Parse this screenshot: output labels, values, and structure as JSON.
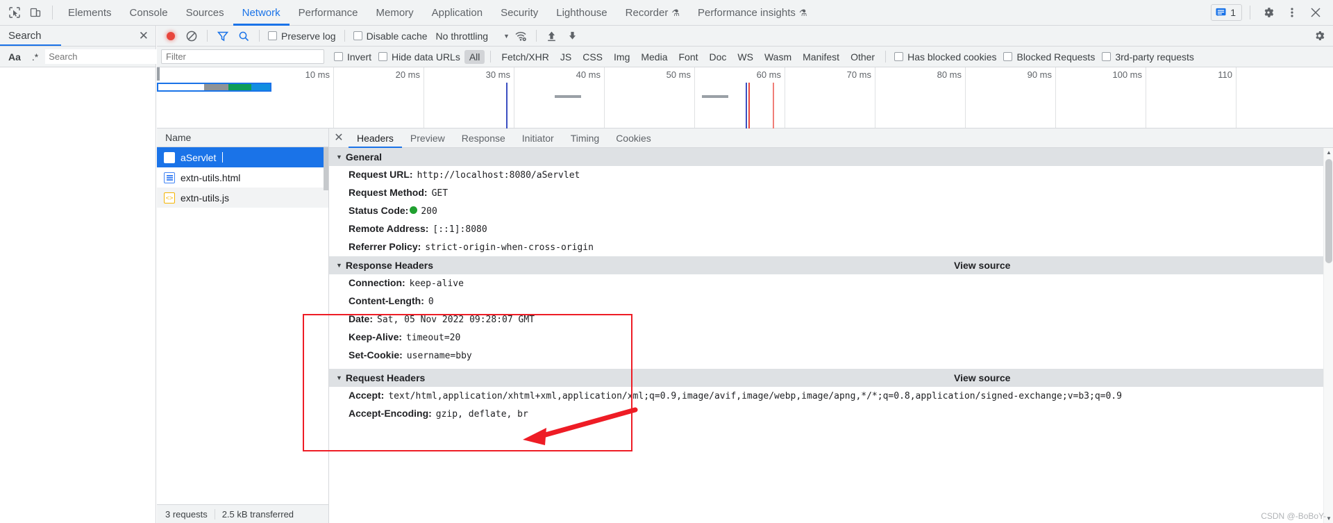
{
  "tabbar": {
    "icons": [
      "inspect-icon",
      "device-toolbar-icon"
    ],
    "tabs": [
      {
        "label": "Elements",
        "flask": false
      },
      {
        "label": "Console",
        "flask": false
      },
      {
        "label": "Sources",
        "flask": false
      },
      {
        "label": "Network",
        "flask": false
      },
      {
        "label": "Performance",
        "flask": false
      },
      {
        "label": "Memory",
        "flask": false
      },
      {
        "label": "Application",
        "flask": false
      },
      {
        "label": "Security",
        "flask": false
      },
      {
        "label": "Lighthouse",
        "flask": false
      },
      {
        "label": "Recorder",
        "flask": true
      },
      {
        "label": "Performance insights",
        "flask": true
      }
    ],
    "active_tab": "Network",
    "issues_count": "1",
    "flask_glyph": "⚗",
    "settings_glyph": "⚙",
    "more_glyph": "⋮",
    "close_glyph": "✕"
  },
  "sidebar": {
    "title": "Search",
    "close_glyph": "✕",
    "case_label": "Aa",
    "regex_label": ".*",
    "search_placeholder": "Search",
    "search_value": "",
    "refresh_glyph": "⟳",
    "clear_glyph": "⃠"
  },
  "network_toolbar": {
    "record_label": "record",
    "clear_glyph": "⃠",
    "filter_glyph": "filter",
    "search_glyph": "search",
    "preserve_log": "Preserve log",
    "disable_cache": "Disable cache",
    "throttling": "No throttling",
    "caret": "▼",
    "wifi_glyph": "wifi",
    "import_glyph": "↑",
    "export_glyph": "↓",
    "settings_glyph": "⚙"
  },
  "filter_toolbar": {
    "filter_placeholder": "Filter",
    "filter_value": "",
    "invert": "Invert",
    "hide_data_urls": "Hide data URLs",
    "types": [
      "All",
      "Fetch/XHR",
      "JS",
      "CSS",
      "Img",
      "Media",
      "Font",
      "Doc",
      "WS",
      "Wasm",
      "Manifest",
      "Other"
    ],
    "selected_type": "All",
    "has_blocked_cookies": "Has blocked cookies",
    "blocked_requests": "Blocked Requests",
    "third_party_requests": "3rd-party requests"
  },
  "overview": {
    "ticks": [
      "10 ms",
      "20 ms",
      "30 ms",
      "40 ms",
      "50 ms",
      "60 ms",
      "70 ms",
      "80 ms",
      "90 ms",
      "100 ms",
      "110"
    ],
    "bar": {
      "total_label": "aServlet",
      "segments": [
        {
          "name": "queue",
          "color": "#ffffff"
        },
        {
          "name": "stalled",
          "color": "#8f9396"
        },
        {
          "name": "waiting-ttfb",
          "color": "#0d9d58"
        },
        {
          "name": "content-download",
          "color": "#108ee0"
        }
      ],
      "outline_color": "#1a73e8"
    },
    "events": [
      {
        "name": "dom-content-loaded",
        "color": "#3a4ec1"
      },
      {
        "name": "dom-content-loaded-2",
        "color": "#3a4ec1"
      },
      {
        "name": "load-event",
        "color": "#e8453c"
      },
      {
        "name": "load-event-2",
        "color": "#f07e77"
      }
    ]
  },
  "request_list": {
    "column": "Name",
    "rows": [
      {
        "name": "aServlet",
        "icon": "document-icon",
        "selected": true
      },
      {
        "name": "extn-utils.html",
        "icon": "document-icon",
        "selected": false
      },
      {
        "name": "extn-utils.js",
        "icon": "script-icon",
        "selected": false
      }
    ],
    "status": {
      "requests": "3 requests",
      "transferred": "2.5 kB transferred"
    }
  },
  "detail": {
    "close_glyph": "✕",
    "tabs": [
      "Headers",
      "Preview",
      "Response",
      "Initiator",
      "Timing",
      "Cookies"
    ],
    "active_tab": "Headers",
    "view_source_label": "View source",
    "sections": [
      {
        "title": "General",
        "has_view_source": false,
        "rows": [
          {
            "key": "Request URL:",
            "value": "http://localhost:8080/aServlet"
          },
          {
            "key": "Request Method:",
            "value": "GET"
          },
          {
            "key": "Status Code:",
            "value": "200",
            "status_dot": "#20a030"
          },
          {
            "key": "Remote Address:",
            "value": "[::1]:8080"
          },
          {
            "key": "Referrer Policy:",
            "value": "strict-origin-when-cross-origin"
          }
        ]
      },
      {
        "title": "Response Headers",
        "has_view_source": true,
        "rows": [
          {
            "key": "Connection:",
            "value": "keep-alive"
          },
          {
            "key": "Content-Length:",
            "value": "0"
          },
          {
            "key": "Date:",
            "value": "Sat, 05 Nov 2022 09:28:07 GMT"
          },
          {
            "key": "Keep-Alive:",
            "value": "timeout=20"
          },
          {
            "key": "Set-Cookie:",
            "value": "username=bby"
          }
        ]
      },
      {
        "title": "Request Headers",
        "has_view_source": true,
        "rows": [
          {
            "key": "Accept:",
            "value": "text/html,application/xhtml+xml,application/xml;q=0.9,image/avif,image/webp,image/apng,*/*;q=0.8,application/signed-exchange;v=b3;q=0.9"
          },
          {
            "key": "Accept-Encoding:",
            "value": "gzip, deflate, br"
          }
        ]
      }
    ]
  },
  "annotation": {
    "box_color": "#ee1c25",
    "arrow_color": "#ee1c25"
  },
  "watermark": "CSDN @-BoBoY-"
}
